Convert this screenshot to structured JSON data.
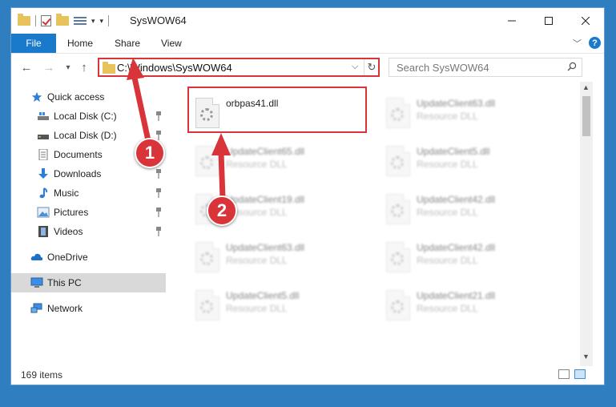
{
  "window": {
    "title": "SysWOW64"
  },
  "ribbon": {
    "tabs": [
      "File",
      "Home",
      "Share",
      "View"
    ],
    "help_label": "?"
  },
  "address": {
    "path": "C:\\Windows\\SysWOW64",
    "search_placeholder": "Search SysWOW64"
  },
  "nav": {
    "items": [
      {
        "label": "Quick access",
        "icon": "star-icon"
      },
      {
        "label": "Local Disk (C:)",
        "icon": "drive-icon",
        "pinned": true
      },
      {
        "label": "Local Disk (D:)",
        "icon": "drive-icon",
        "pinned": true
      },
      {
        "label": "Documents",
        "icon": "documents-icon",
        "pinned": true
      },
      {
        "label": "Downloads",
        "icon": "download-icon",
        "pinned": true
      },
      {
        "label": "Music",
        "icon": "music-icon",
        "pinned": true
      },
      {
        "label": "Pictures",
        "icon": "pictures-icon",
        "pinned": true
      },
      {
        "label": "Videos",
        "icon": "videos-icon",
        "pinned": true
      },
      {
        "label": "OneDrive",
        "icon": "cloud-icon"
      },
      {
        "label": "This PC",
        "icon": "computer-icon",
        "selected": true
      },
      {
        "label": "Network",
        "icon": "network-icon"
      }
    ]
  },
  "files": {
    "highlighted": {
      "name": "orbpas41.dll"
    },
    "blurred": [
      {
        "name": "UpdateClient63.dll",
        "type": "Resource DLL"
      },
      {
        "name": "UpdateClient65.dll",
        "type": "Resource DLL"
      },
      {
        "name": "UpdateClient5.dll",
        "type": "Resource DLL"
      },
      {
        "name": "UpdateClient19.dll",
        "type": "Resource DLL"
      },
      {
        "name": "UpdateClient42.dll",
        "type": "Resource DLL"
      },
      {
        "name": "UpdateClient63.dll",
        "type": "Resource DLL"
      },
      {
        "name": "UpdateClient42.dll",
        "type": "Resource DLL"
      },
      {
        "name": "UpdateClient5.dll",
        "type": "Resource DLL"
      },
      {
        "name": "UpdateClient21.dll",
        "type": "Resource DLL"
      }
    ]
  },
  "status": {
    "item_count": "169 items"
  },
  "callouts": [
    "1",
    "2"
  ],
  "colors": {
    "accent": "#1979ca",
    "highlight": "#d9343a",
    "desktop": "#2f7fc0"
  }
}
